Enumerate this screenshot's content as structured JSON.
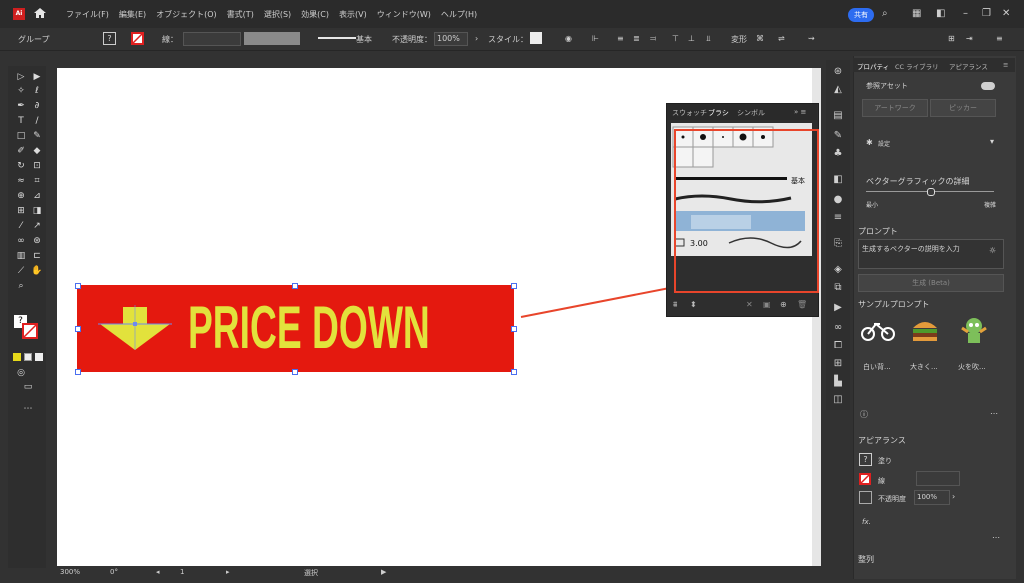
{
  "menubar": {
    "app_icon": "illustrator-logo-icon",
    "items": [
      "ファイル(F)",
      "編集(E)",
      "オブジェクト(O)",
      "書式(T)",
      "選択(S)",
      "効果(C)",
      "表示(V)",
      "ウィンドウ(W)",
      "ヘルプ(H)"
    ],
    "share_label": "共有"
  },
  "controlbar": {
    "selection_type": "グループ",
    "stroke_label": "線：",
    "stroke_style": "基本",
    "opacity_label": "不透明度：",
    "opacity_value": "100%",
    "style_label": "スタイル：",
    "transform_label": "変形"
  },
  "canvas": {
    "banner_text": "PRICE DOWN",
    "banner_bg": "#e4190f",
    "banner_fg": "#e2e23c",
    "arrow_color": "#e8452b"
  },
  "brush_panel": {
    "tabs": [
      "スウォッチ",
      "ブラシ",
      "シンボル"
    ],
    "stroke_name": "基本",
    "brush_size": "3.00"
  },
  "properties_panel": {
    "tabs": [
      "プロパティ",
      "CC ライブラリ",
      "アピアランス"
    ],
    "ref_assets_label": "参照アセット",
    "artwork_button": "アートワーク",
    "picker_button": "ピッカー",
    "settings_label": "設定",
    "detail_label": "ベクターグラフィックの詳細",
    "detail_min": "最小",
    "detail_max": "複雑",
    "prompt_heading": "プロンプト",
    "prompt_placeholder": "生成するベクターの説明を入力",
    "generate_button": "生成 (Beta)",
    "sample_heading": "サンプルプロンプト",
    "samples": [
      "白い背...",
      "大きく...",
      "火を吹..."
    ],
    "appearance_heading": "アピアランス",
    "fill_label": "塗り",
    "stroke_label": "線",
    "opacity_label": "不透明度",
    "opacity_value": "100%",
    "fx_label": "fx.",
    "align_heading": "整列"
  },
  "statusbar": {
    "zoom": "300%",
    "rotation": "0°",
    "artboard": "1",
    "tool": "選択"
  }
}
